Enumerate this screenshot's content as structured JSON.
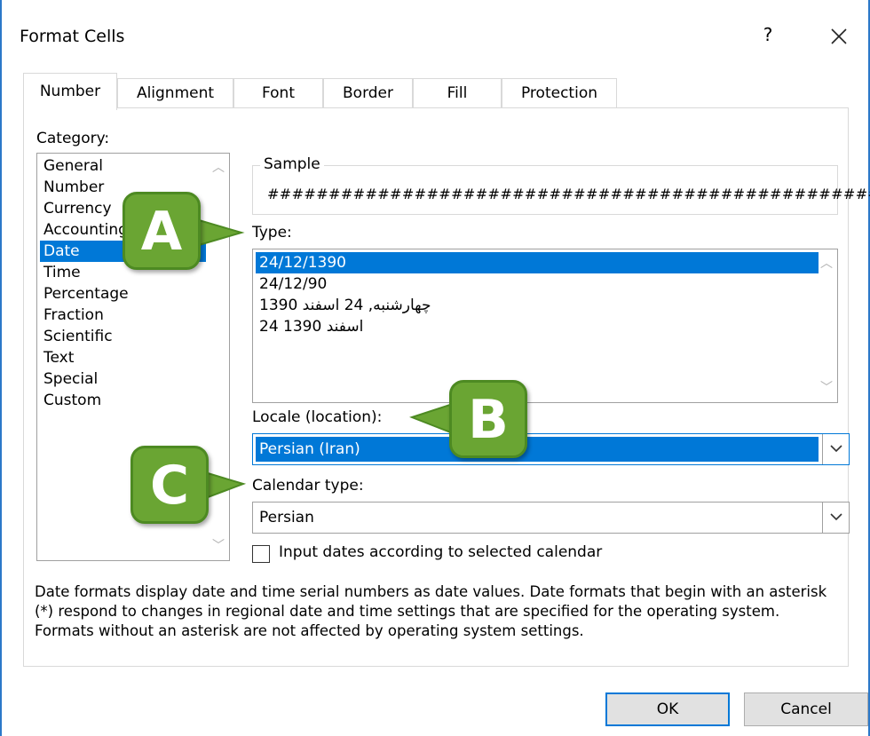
{
  "window": {
    "title": "Format Cells",
    "help": "?",
    "close": "✕"
  },
  "tabs": [
    "Number",
    "Alignment",
    "Font",
    "Border",
    "Fill",
    "Protection"
  ],
  "category": {
    "label": "Category:",
    "items": [
      "General",
      "Number",
      "Currency",
      "Accounting",
      "Date",
      "Time",
      "Percentage",
      "Fraction",
      "Scientific",
      "Text",
      "Special",
      "Custom"
    ],
    "selected": "Date"
  },
  "sample": {
    "legend": "Sample",
    "value": "##################################################"
  },
  "type": {
    "label": "Type:",
    "items": [
      "24/12/1390",
      "24/12/90",
      "چهارشنبه, 24 اسفند 1390",
      "24 اسفند 1390"
    ],
    "selected": "24/12/1390"
  },
  "locale": {
    "label": "Locale (location):",
    "value": "Persian (Iran)"
  },
  "calendar": {
    "label": "Calendar type:",
    "value": "Persian"
  },
  "checkbox": {
    "label": "Input dates according to selected calendar",
    "checked": false
  },
  "description": "Date formats display date and time serial numbers as date values.  Date formats that begin with an asterisk (*) respond to changes in regional date and time settings that are specified for the operating system. Formats without an asterisk are not affected by operating system settings.",
  "buttons": {
    "ok": "OK",
    "cancel": "Cancel"
  },
  "callouts": {
    "a": "A",
    "b": "B",
    "c": "C",
    "color": "#6aa533"
  },
  "colors": {
    "selection": "#0078d7",
    "border_accent": "#2b78c8"
  }
}
